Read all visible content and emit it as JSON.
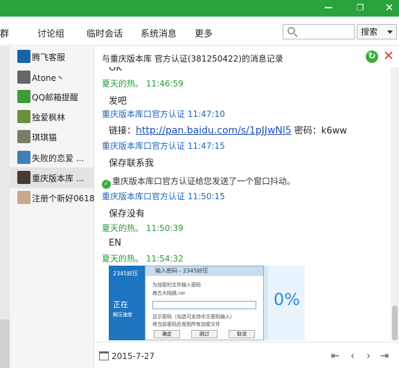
{
  "colors": {
    "titlebar": "#2aa33c",
    "sender_me": "#2a9a3a",
    "sender_other": "#1a67b8",
    "link": "#1a4db8"
  },
  "titlebar": {
    "restore_icon": "restore-icon",
    "close_icon": "close-icon"
  },
  "navbar": {
    "tabs": [
      "群",
      "讨论组",
      "临时会话",
      "系统消息",
      "更多"
    ],
    "search_placeholder": "",
    "search_button": "搜索"
  },
  "contacts": [
    {
      "name": "腾飞客服",
      "avatar_color": "#1565a8",
      "selected": false
    },
    {
      "name": "Atone丶",
      "avatar_color": "#666666",
      "selected": false
    },
    {
      "name": "QQ邮箱提醒",
      "avatar_color": "#3f9b38",
      "selected": false
    },
    {
      "name": "独爱枫林",
      "avatar_color": "#6d8f3a",
      "selected": false
    },
    {
      "name": "琪琪猫",
      "avatar_color": "#7b7d6a",
      "selected": false
    },
    {
      "name": "失败的恋爱 ...",
      "avatar_color": "#3f7fb4",
      "selected": false
    },
    {
      "name": "重庆版本库 ...",
      "avatar_color": "#4a3b32",
      "selected": true
    },
    {
      "name": "注册个新好0618",
      "avatar_color": "#caa88a",
      "selected": false
    }
  ],
  "chat": {
    "title": "与重庆版本库  官方认证(381250422)的消息记录",
    "partial_top": "OK",
    "messages": [
      {
        "kind": "sender-me",
        "text": "夏天的热。 11:46:59"
      },
      {
        "kind": "body",
        "text": "发吧"
      },
      {
        "kind": "sender-other",
        "text": "重庆版本库口官方认证 11:47:10"
      },
      {
        "kind": "body",
        "prefix": "链接：",
        "link": "http://pan.baidu.com/s/1pJJwNl5",
        "suffix": " 密码：k6ww"
      },
      {
        "kind": "sender-other",
        "text": "重庆版本库口官方认证 11:47:15"
      },
      {
        "kind": "body",
        "text": "保存联系我"
      },
      {
        "kind": "sys",
        "text": "重庆版本库口官方认证给您发送了一个窗口抖动。"
      },
      {
        "kind": "sender-other",
        "text": "重庆版本库口官方认证 11:50:15"
      },
      {
        "kind": "body",
        "text": "保存没有"
      },
      {
        "kind": "sender-me",
        "text": "夏天的热。 11:50:39"
      },
      {
        "kind": "body",
        "text": "EN"
      },
      {
        "kind": "sender-me",
        "text": "夏天的热。 11:54:32"
      }
    ],
    "screenshot": {
      "dialog_title": "输入密码 - 2345好压",
      "line1": "为加密的文件输入密码",
      "line2": "搭古大陆跳.rar",
      "opt1": "显示密码（勾选可支持中文密码输入）",
      "opt2": "将当前密码应用到所有加密文件",
      "btn_ok": "确定",
      "btn_skip": "跳过",
      "btn_cancel": "取消",
      "left_title": "正在",
      "left_sub": "解压速度",
      "left_logo": "2345好压",
      "percent": "0%"
    }
  },
  "footer": {
    "date": "2015-7-27"
  }
}
